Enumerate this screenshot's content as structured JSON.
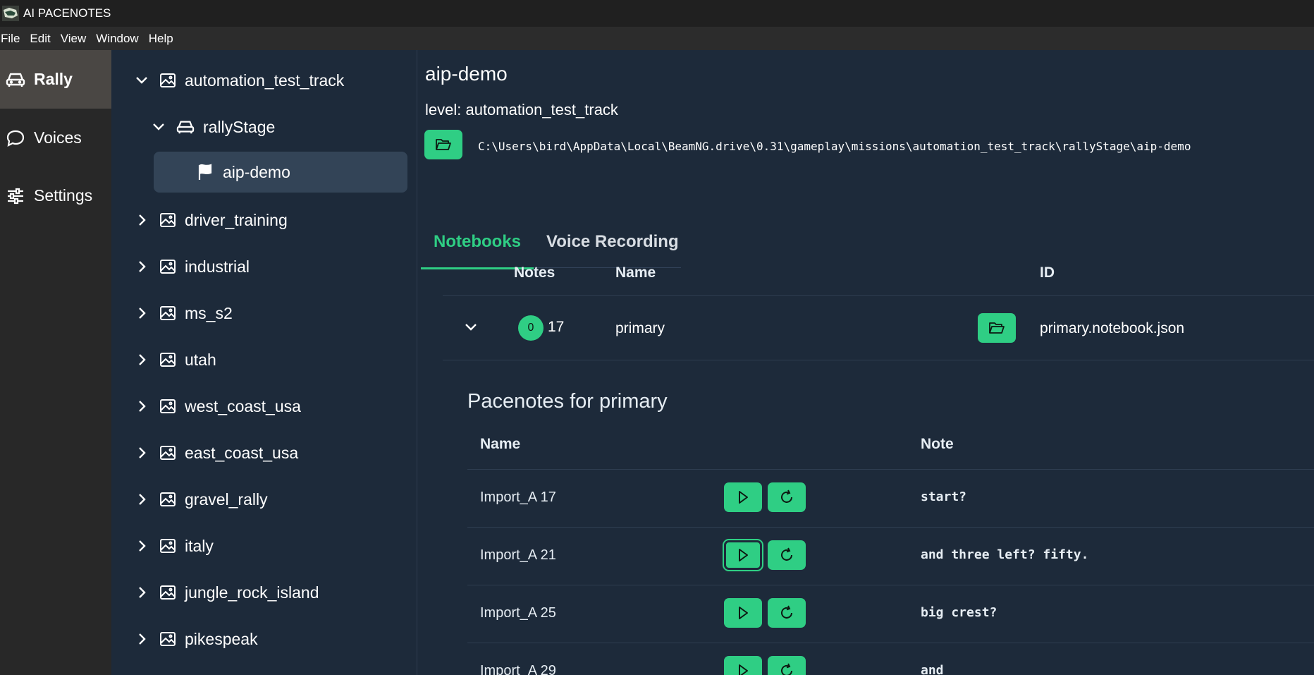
{
  "window": {
    "title": "AI PACENOTES"
  },
  "menu": [
    "File",
    "Edit",
    "View",
    "Window",
    "Help"
  ],
  "nav": {
    "items": [
      {
        "label": "Rally",
        "icon": "car-icon",
        "active": true
      },
      {
        "label": "Voices",
        "icon": "chat-bubble-icon",
        "active": false
      },
      {
        "label": "Settings",
        "icon": "sliders-icon",
        "active": false
      }
    ]
  },
  "tree": {
    "items": [
      {
        "label": "automation_test_track",
        "icon": "image-icon",
        "expanded": true
      },
      {
        "label": "rallyStage",
        "icon": "car-icon",
        "expanded": true
      },
      {
        "label": "aip-demo",
        "icon": "flag-icon",
        "selected": true
      },
      {
        "label": "driver_training",
        "icon": "image-icon"
      },
      {
        "label": "industrial",
        "icon": "image-icon"
      },
      {
        "label": "ms_s2",
        "icon": "image-icon"
      },
      {
        "label": "utah",
        "icon": "image-icon"
      },
      {
        "label": "west_coast_usa",
        "icon": "image-icon"
      },
      {
        "label": "east_coast_usa",
        "icon": "image-icon"
      },
      {
        "label": "gravel_rally",
        "icon": "image-icon"
      },
      {
        "label": "italy",
        "icon": "image-icon"
      },
      {
        "label": "jungle_rock_island",
        "icon": "image-icon"
      },
      {
        "label": "pikespeak",
        "icon": "image-icon"
      }
    ]
  },
  "mission": {
    "title": "aip-demo",
    "level": "level: automation_test_track",
    "path": "C:\\Users\\bird\\AppData\\Local\\BeamNG.drive\\0.31\\gameplay\\missions\\automation_test_track\\rallyStage\\aip-demo"
  },
  "tabs": [
    {
      "label": "Notebooks",
      "active": true
    },
    {
      "label": "Voice Recording",
      "active": false
    }
  ],
  "notebooks": {
    "headers": {
      "notes": "Notes",
      "name": "Name",
      "id": "ID"
    },
    "rows": [
      {
        "badge": "0",
        "count": "17",
        "name": "primary",
        "id": "primary.notebook.json"
      }
    ]
  },
  "pacenotes": {
    "title": "Pacenotes for primary",
    "headers": {
      "name": "Name",
      "note": "Note"
    },
    "rows": [
      {
        "name": "Import_A 17",
        "note": "start?"
      },
      {
        "name": "Import_A 21",
        "note": "and three left? fifty."
      },
      {
        "name": "Import_A 25",
        "note": "big crest?"
      },
      {
        "name": "Import_A 29",
        "note": "and"
      }
    ]
  },
  "colors": {
    "accent": "#2fce84",
    "background": "#1d2a3a",
    "nav_bg": "#282828"
  }
}
